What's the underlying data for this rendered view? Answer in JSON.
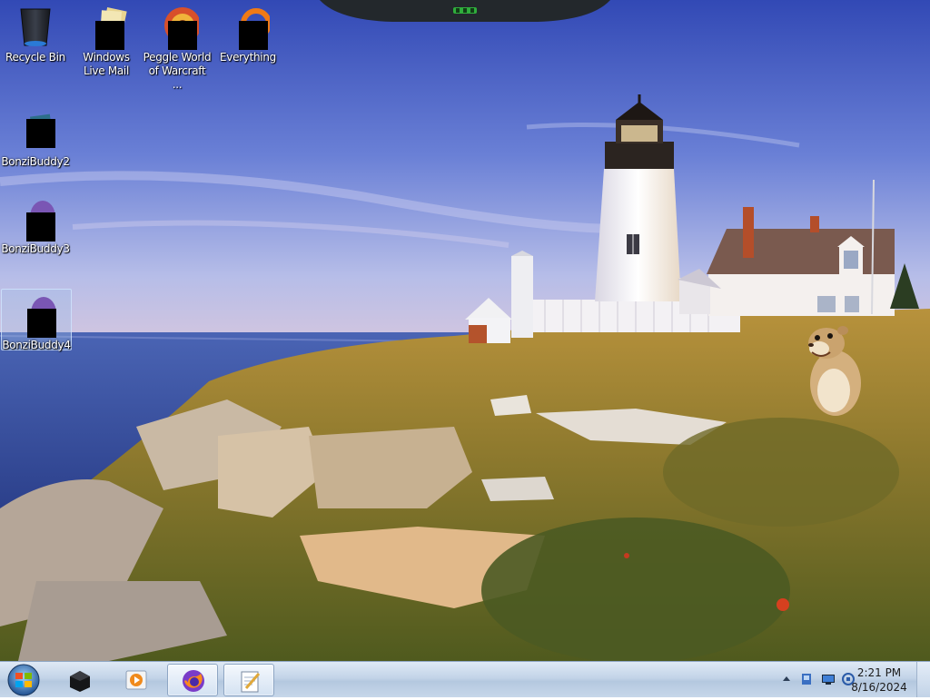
{
  "desktop": {
    "icons": [
      {
        "label": "Recycle Bin"
      },
      {
        "label": "Windows Live Mail"
      },
      {
        "label": "Peggle World of Warcraft ..."
      },
      {
        "label": "Everything"
      },
      {
        "label": "BonziBuddy2"
      },
      {
        "label": "BonziBuddy3"
      },
      {
        "label": "BonziBuddy4"
      }
    ]
  },
  "taskbar": {
    "pinned": [
      {
        "icon": "windows-start-orb-icon"
      },
      {
        "icon": "media-center-icon"
      },
      {
        "icon": "media-player-icon"
      },
      {
        "icon": "firefox-icon"
      },
      {
        "icon": "notepad-icon"
      }
    ]
  },
  "tray": {
    "time": "2:21 PM",
    "date": "8/16/2024",
    "icons": [
      "show-hidden-icons-chevron",
      "action-center-icon",
      "network-icon",
      "volume-icon"
    ]
  },
  "colors": {
    "sky_top": "#3a55b8",
    "sky_bottom": "#bcc4e6",
    "sea": "#3f5aa8",
    "grass": "#9a7a2c",
    "taskbar": "#c3d4e8"
  }
}
